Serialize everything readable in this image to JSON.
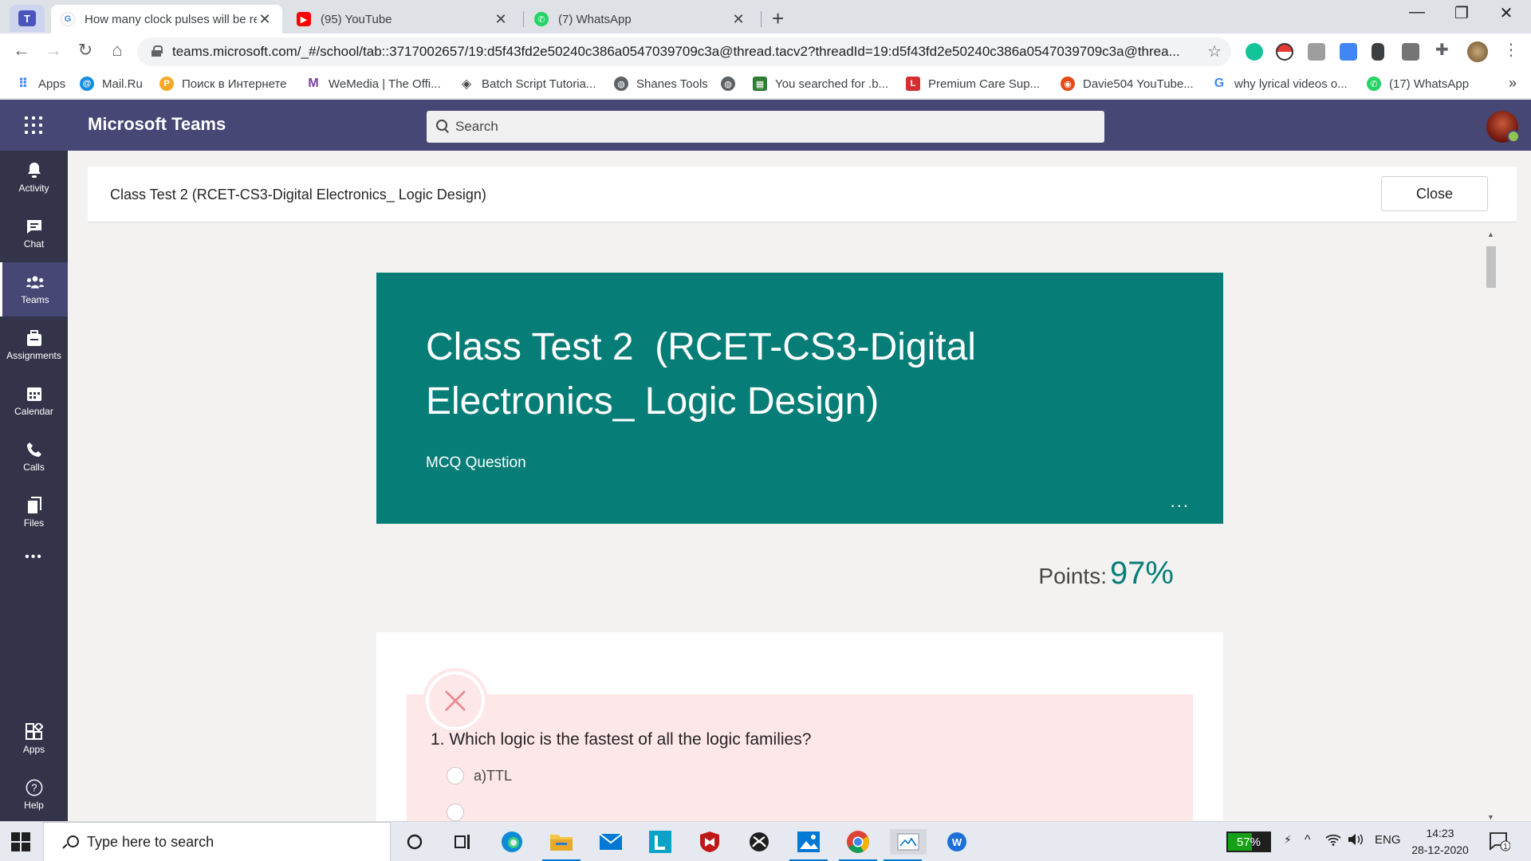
{
  "browser": {
    "tabs": [
      {
        "label": "How many clock pulses will be re",
        "active": true,
        "favicon": "google-icon"
      },
      {
        "label": "(95) YouTube",
        "active": false,
        "favicon": "youtube-icon"
      },
      {
        "label": "(7) WhatsApp",
        "active": false,
        "favicon": "whatsapp-icon"
      }
    ],
    "url": "teams.microsoft.com/_#/school/tab::3717002657/19:d5f43fd2e50240c386a0547039709c3a@thread.tacv2?threadId=19:d5f43fd2e50240c386a0547039709c3a@threa...",
    "bookmarks": [
      {
        "label": "Apps",
        "icon": "apps-grid-icon",
        "color": "#4285f4"
      },
      {
        "label": "Mail.Ru",
        "icon": "mailru-icon",
        "color": "#168de2"
      },
      {
        "label": "Поиск в Интернете",
        "icon": "search-globe-icon",
        "color": "#f9a825"
      },
      {
        "label": "WeMedia | The Offi...",
        "icon": "wemedia-icon",
        "color": "#7b3fa0"
      },
      {
        "label": "Batch Script Tutoria...",
        "icon": "tutorial-icon",
        "color": "#444444"
      },
      {
        "label": "Shanes Tools",
        "icon": "globe-icon",
        "color": "#5f6368"
      },
      {
        "label": "",
        "icon": "globe-icon",
        "color": "#5f6368"
      },
      {
        "label": "You searched for .b...",
        "icon": "grid-site-icon",
        "color": "#2e7d32"
      },
      {
        "label": "Premium Care Sup...",
        "icon": "premium-care-icon",
        "color": "#d32f2f"
      },
      {
        "label": "Davie504 YouTube...",
        "icon": "davie-icon",
        "color": "#e64a19"
      },
      {
        "label": "why lyrical videos o...",
        "icon": "google-icon",
        "color": "#4285f4"
      },
      {
        "label": "(17) WhatsApp",
        "icon": "whatsapp-icon",
        "color": "#25d366"
      }
    ],
    "bookmarks_overflow": "»"
  },
  "teams": {
    "app_title": "Microsoft Teams",
    "search_placeholder": "Search",
    "rail": [
      {
        "label": "Activity",
        "icon": "bell-icon",
        "active": false
      },
      {
        "label": "Chat",
        "icon": "chat-icon",
        "active": false
      },
      {
        "label": "Teams",
        "icon": "teams-icon",
        "active": true
      },
      {
        "label": "Assignments",
        "icon": "assignments-icon",
        "active": false
      },
      {
        "label": "Calendar",
        "icon": "calendar-icon",
        "active": false
      },
      {
        "label": "Calls",
        "icon": "phone-icon",
        "active": false
      },
      {
        "label": "Files",
        "icon": "files-icon",
        "active": false
      }
    ],
    "rail_more": "•••",
    "rail_bottom": [
      {
        "label": "Apps",
        "icon": "apps-icon"
      },
      {
        "label": "Help",
        "icon": "help-icon"
      }
    ]
  },
  "form": {
    "topbar_title": "Class Test 2 (RCET-CS3-Digital Electronics_ Logic Design)",
    "close_label": "Close",
    "title": "Class Test 2  (RCET-CS3-Digital Electronics_ Logic Design)",
    "subtitle": "MCQ Question",
    "more": "...",
    "points_label": "Points:",
    "points_value": "97%",
    "question": {
      "number": "1.",
      "text": "Which logic is the fastest of all the logic families?",
      "status": "incorrect",
      "options": [
        "a)TTL"
      ]
    },
    "colors": {
      "accent": "#077d77",
      "incorrect_bg": "#fde7e9",
      "incorrect_icon": "#e9878c"
    }
  },
  "taskbar": {
    "search_placeholder": "Type here to search",
    "battery": "57%",
    "battery_level": 0.57,
    "language": "ENG",
    "time": "14:23",
    "date": "28-12-2020",
    "notifications": "1"
  }
}
